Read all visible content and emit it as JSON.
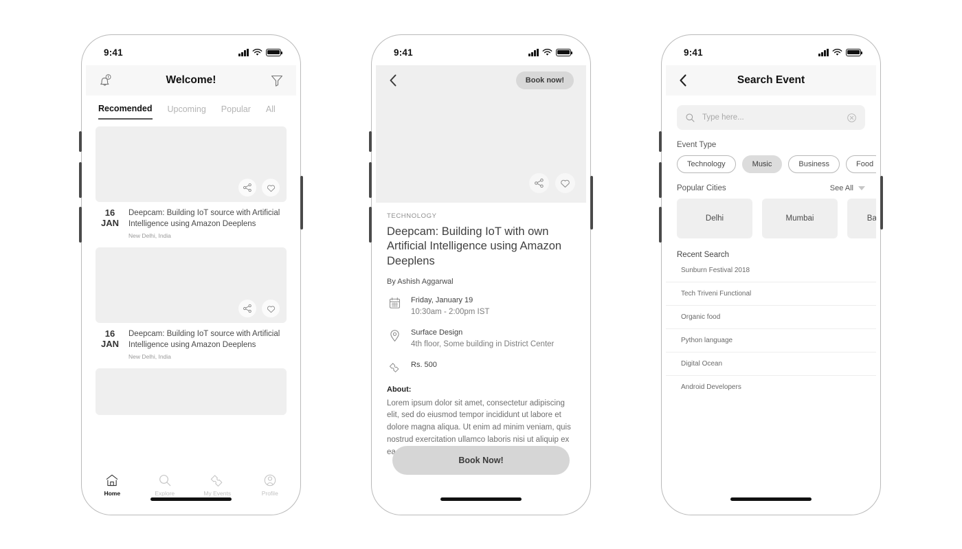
{
  "status_bar": {
    "time": "9:41",
    "signal_icon": "signal-bars-icon",
    "wifi_icon": "wifi-icon",
    "battery_icon": "battery-icon"
  },
  "screen_home": {
    "nav": {
      "title": "Welcome!",
      "bell_icon": "notification-bell-icon",
      "filter_icon": "filter-funnel-icon"
    },
    "tabs": [
      {
        "label": "Recomended",
        "active": true
      },
      {
        "label": "Upcoming",
        "active": false
      },
      {
        "label": "Popular",
        "active": false
      },
      {
        "label": "All",
        "active": false
      }
    ],
    "events": [
      {
        "day": "16",
        "month": "JAN",
        "title": "Deepcam: Building IoT source with Artificial Intelligence using Amazon Deeplens",
        "location": "New Delhi, India"
      },
      {
        "day": "16",
        "month": "JAN",
        "title": "Deepcam: Building IoT source with Artificial Intelligence using Amazon Deeplens",
        "location": "New Delhi, India"
      }
    ],
    "card_actions": {
      "share_icon": "share-icon",
      "favorite_icon": "heart-icon"
    },
    "tabbar": [
      {
        "label": "Home",
        "icon": "home-icon",
        "active": true
      },
      {
        "label": "Explore",
        "icon": "search-icon",
        "active": false
      },
      {
        "label": "My Events",
        "icon": "ticket-icon",
        "active": false
      },
      {
        "label": "Profile",
        "icon": "person-icon",
        "active": false
      }
    ]
  },
  "screen_detail": {
    "nav": {
      "back_icon": "back-chevron-icon",
      "book_pill": "Book now!"
    },
    "hero_actions": {
      "share_icon": "share-icon",
      "favorite_icon": "heart-icon"
    },
    "category": "TECHNOLOGY",
    "title": "Deepcam: Building IoT with own Artificial Intelligence using Amazon Deeplens",
    "author": "By Ashish Aggarwal",
    "meta": [
      {
        "icon": "calendar-icon",
        "line1": "Friday, January 19",
        "line2": "10:30am - 2:00pm IST"
      },
      {
        "icon": "location-pin-icon",
        "line1": "Surface Design",
        "line2": "4th floor, Some building in District Center"
      },
      {
        "icon": "ticket-icon",
        "line1": "Rs. 500",
        "line2": ""
      }
    ],
    "about_heading": "About:",
    "about_body": "Lorem ipsum dolor sit amet, consectetur adipiscing elit, sed do eiusmod tempor incididunt ut labore et dolore magna aliqua. Ut enim ad minim veniam, quis nostrud exercitation ullamco laboris nisi ut aliquip ex ea commodo",
    "book_button": "Book Now!"
  },
  "screen_search": {
    "nav": {
      "title": "Search Event",
      "back_icon": "back-chevron-icon"
    },
    "search": {
      "placeholder": "Type here...",
      "search_icon": "search-icon",
      "clear_icon": "clear-circle-icon"
    },
    "event_type_heading": "Event Type",
    "event_types": [
      {
        "label": "Technology",
        "selected": false
      },
      {
        "label": "Music",
        "selected": true
      },
      {
        "label": "Business",
        "selected": false
      },
      {
        "label": "Food",
        "selected": false
      }
    ],
    "popular_cities_heading": "Popular Cities",
    "see_all": "See All",
    "see_all_icon": "chevron-down-icon",
    "cities": [
      "Delhi",
      "Mumbai",
      "Bangalore"
    ],
    "recent_search_heading": "Recent Search",
    "recent_searches": [
      "Sunburn Festival 2018",
      "Tech Triveni Functional",
      "Organic food",
      "Python language",
      "Digital Ocean",
      "Android Developers"
    ]
  }
}
